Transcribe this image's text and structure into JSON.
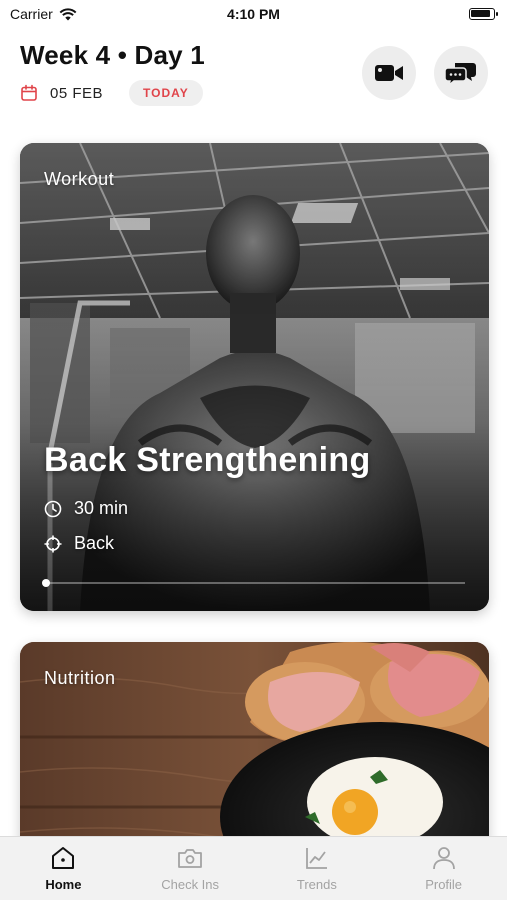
{
  "status_bar": {
    "carrier": "Carrier",
    "time": "4:10 PM"
  },
  "header": {
    "title": "Week 4 • Day 1",
    "date": "05 FEB",
    "today_label": "TODAY",
    "accent_color": "#e0444a"
  },
  "actions": {
    "video_icon": "video-camera-icon",
    "chat_icon": "chat-bubbles-icon"
  },
  "workout_card": {
    "label": "Workout",
    "title": "Back Strengthening",
    "duration": "30 min",
    "target": "Back",
    "duration_icon": "clock-icon",
    "target_icon": "crosshair-icon",
    "progress": 0
  },
  "nutrition_card": {
    "label": "Nutrition"
  },
  "tab_bar": {
    "items": [
      {
        "label": "Home",
        "icon": "home-icon",
        "active": true
      },
      {
        "label": "Check Ins",
        "icon": "camera-icon",
        "active": false
      },
      {
        "label": "Trends",
        "icon": "chart-icon",
        "active": false
      },
      {
        "label": "Profile",
        "icon": "person-icon",
        "active": false
      }
    ]
  }
}
